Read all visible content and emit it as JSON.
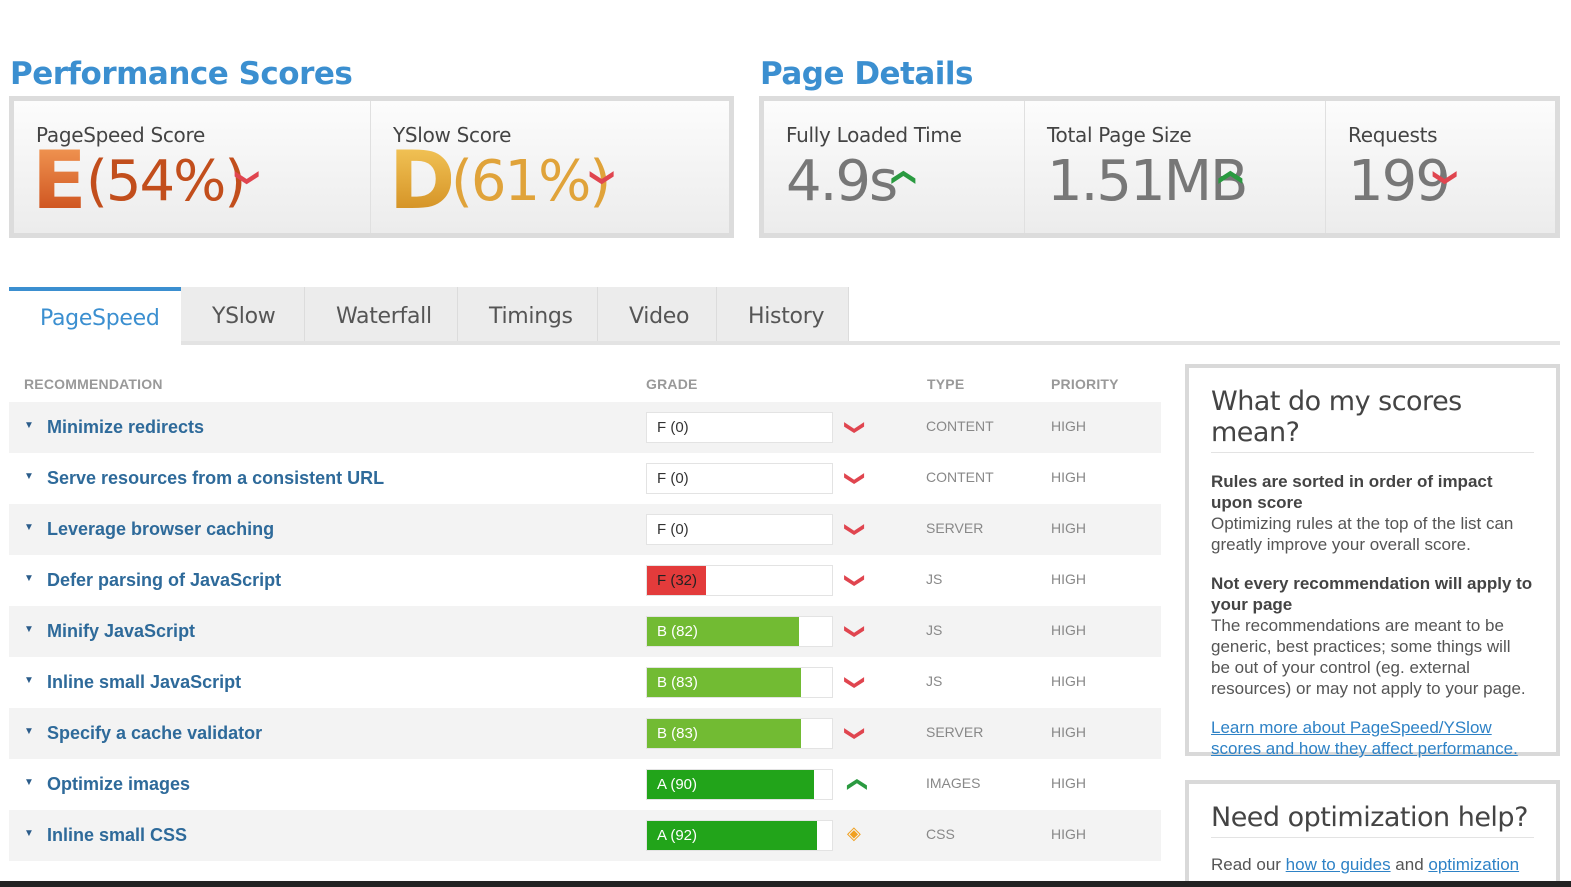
{
  "scores": {
    "title": "Performance Scores",
    "pagespeed": {
      "label": "PageSpeed Score",
      "grade": "E",
      "pct": "(54%)",
      "trend": "down"
    },
    "yslow": {
      "label": "YSlow Score",
      "grade": "D",
      "pct": "(61%)",
      "trend": "down"
    }
  },
  "details": {
    "title": "Page Details",
    "load": {
      "label": "Fully Loaded Time",
      "value": "4.9s",
      "trend": "up"
    },
    "size": {
      "label": "Total Page Size",
      "value": "1.51MB",
      "trend": "up"
    },
    "requests": {
      "label": "Requests",
      "value": "199",
      "trend": "down"
    }
  },
  "tabs": [
    "PageSpeed",
    "YSlow",
    "Waterfall",
    "Timings",
    "Video",
    "History"
  ],
  "active_tab": "PageSpeed",
  "table": {
    "headers": {
      "recommendation": "RECOMMENDATION",
      "grade": "GRADE",
      "type": "TYPE",
      "priority": "PRIORITY"
    },
    "rows": [
      {
        "name": "Minimize redirects",
        "grade": "F (0)",
        "score": 0,
        "color": "#e33b3b",
        "trend": "down",
        "type": "CONTENT",
        "priority": "HIGH"
      },
      {
        "name": "Serve resources from a consistent URL",
        "grade": "F (0)",
        "score": 0,
        "color": "#e33b3b",
        "trend": "down",
        "type": "CONTENT",
        "priority": "HIGH"
      },
      {
        "name": "Leverage browser caching",
        "grade": "F (0)",
        "score": 0,
        "color": "#e33b3b",
        "trend": "down",
        "type": "SERVER",
        "priority": "HIGH"
      },
      {
        "name": "Defer parsing of JavaScript",
        "grade": "F (32)",
        "score": 32,
        "color": "#e33b3b",
        "trend": "down",
        "type": "JS",
        "priority": "HIGH"
      },
      {
        "name": "Minify JavaScript",
        "grade": "B (82)",
        "score": 82,
        "color": "#72bb33",
        "trend": "down",
        "type": "JS",
        "priority": "HIGH"
      },
      {
        "name": "Inline small JavaScript",
        "grade": "B (83)",
        "score": 83,
        "color": "#72bb33",
        "trend": "down",
        "type": "JS",
        "priority": "HIGH"
      },
      {
        "name": "Specify a cache validator",
        "grade": "B (83)",
        "score": 83,
        "color": "#72bb33",
        "trend": "down",
        "type": "SERVER",
        "priority": "HIGH"
      },
      {
        "name": "Optimize images",
        "grade": "A (90)",
        "score": 90,
        "color": "#22a41a",
        "trend": "up",
        "type": "IMAGES",
        "priority": "HIGH"
      },
      {
        "name": "Inline small CSS",
        "grade": "A (92)",
        "score": 92,
        "color": "#22a41a",
        "trend": "avg",
        "type": "CSS",
        "priority": "HIGH"
      }
    ]
  },
  "side1": {
    "title": "What do my scores mean?",
    "b1": "Rules are sorted in order of impact upon score",
    "p1": "Optimizing rules at the top of the list can greatly improve your overall score.",
    "b2": "Not every recommendation will apply to your page",
    "p2": "The recommendations are meant to be generic, best practices; some things will be out of your control (eg. external resources) or may not apply to your page.",
    "link": "Learn more about PageSpeed/YSlow scores and how they affect performance."
  },
  "side2": {
    "title": "Need optimization help?",
    "text_pre": "Read our ",
    "link1": "how to guides",
    "text_mid": " and ",
    "link2": "optimization"
  }
}
